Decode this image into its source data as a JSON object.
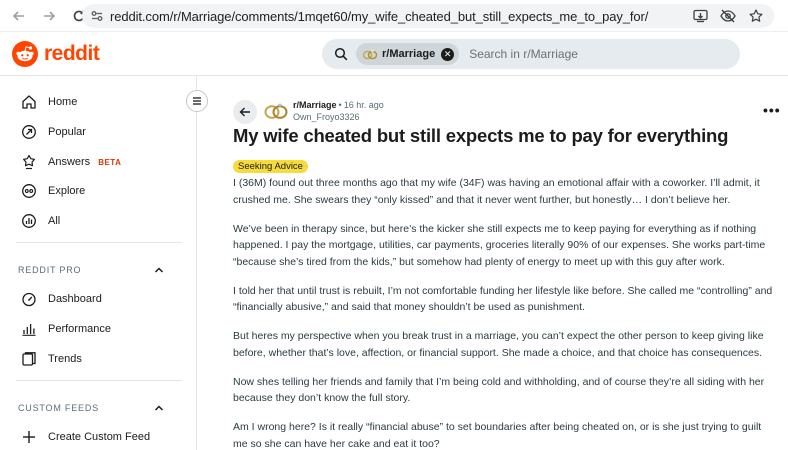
{
  "browser": {
    "url": "reddit.com/r/Marriage/comments/1mqet60/my_wife_cheated_but_still_expects_me_to_pay_for/"
  },
  "header": {
    "logo_text": "reddit",
    "brand_color": "#ff4500",
    "search": {
      "chip_label": "r/Marriage",
      "placeholder": "Search in r/Marriage"
    }
  },
  "sidebar": {
    "nav": [
      {
        "label": "Home",
        "icon": "home-icon"
      },
      {
        "label": "Popular",
        "icon": "popular-icon"
      },
      {
        "label": "Answers",
        "icon": "answers-icon",
        "badge": "BETA"
      },
      {
        "label": "Explore",
        "icon": "explore-icon"
      },
      {
        "label": "All",
        "icon": "all-icon"
      }
    ],
    "reddit_pro": {
      "heading": "REDDIT PRO",
      "items": [
        {
          "label": "Dashboard",
          "icon": "dashboard-icon"
        },
        {
          "label": "Performance",
          "icon": "performance-icon"
        },
        {
          "label": "Trends",
          "icon": "trends-icon"
        }
      ]
    },
    "custom_feeds": {
      "heading": "CUSTOM FEEDS",
      "items": [
        {
          "label": "Create Custom Feed",
          "icon": "plus-icon"
        }
      ]
    }
  },
  "post": {
    "subreddit": "r/Marriage",
    "age": "16 hr. ago",
    "author": "Own_Froyo3326",
    "title": "My wife cheated but still expects me to pay for everything",
    "flair": "Seeking Advice",
    "flair_color": "#f5db3b",
    "paragraphs": [
      "I (36M) found out three months ago that my wife (34F) was having an emotional affair with a coworker. I’ll admit, it crushed me. She swears they “only kissed” and that it never went further, but honestly… I don’t believe her.",
      "We’ve been in therapy since, but here’s the kicker she still expects me to keep paying for everything as if nothing happened. I pay the mortgage, utilities, car payments, groceries literally 90% of our expenses. She works part-time “because she’s tired from the kids,” but somehow had plenty of energy to meet up with this guy after work.",
      "I told her that until trust is rebuilt, I’m not comfortable funding her lifestyle like before. She called me “controlling” and “financially abusive,” and said that money shouldn’t be used as punishment.",
      "But heres my perspective when you break trust in a marriage, you can’t expect the other person to keep giving like before, whether that’s love, affection, or financial support. She made a choice, and that choice has consequences.",
      "Now shes telling her friends and family that I’m being cold and withholding, and of course they’re all siding with her because they don’t know the full story.",
      "Am I wrong here? Is it really “financial abuse” to set boundaries after being cheated on, or is she just trying to guilt me so she can have her cake and eat it too?"
    ]
  }
}
